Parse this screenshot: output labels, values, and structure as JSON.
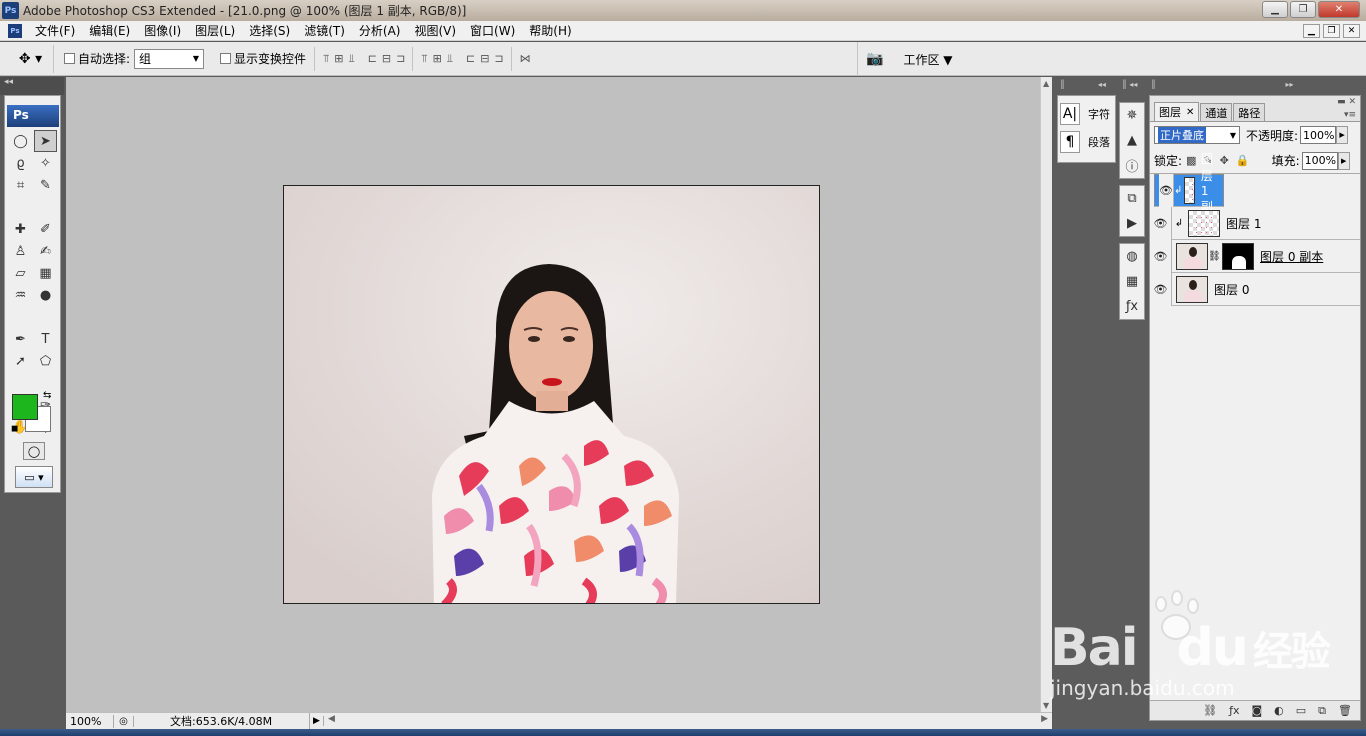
{
  "window": {
    "title": "Adobe Photoshop CS3 Extended - [21.0.png @ 100% (图层 1 副本, RGB/8)]",
    "app_icon": "Ps"
  },
  "menu": [
    "文件(F)",
    "编辑(E)",
    "图像(I)",
    "图层(L)",
    "选择(S)",
    "滤镜(T)",
    "分析(A)",
    "视图(V)",
    "窗口(W)",
    "帮助(H)"
  ],
  "options": {
    "auto_select_label": "自动选择:",
    "auto_select_value": "组",
    "show_transform_label": "显示变换控件",
    "workspace_label": "工作区"
  },
  "toolbox": {
    "logo": "Ps",
    "fg_color": "#1db71d",
    "bg_color": "#ffffff"
  },
  "statusbar": {
    "zoom": "100%",
    "doc_info": "文档:653.6K/4.08M"
  },
  "char_panel": {
    "char_label": "字符",
    "para_label": "段落"
  },
  "layers_panel": {
    "tabs": [
      "图层",
      "通道",
      "路径"
    ],
    "blend_mode": "正片叠底",
    "opacity_label": "不透明度:",
    "opacity": "100%",
    "lock_label": "锁定:",
    "fill_label": "填充:",
    "fill": "100%",
    "layers": [
      {
        "name": "图层 1 副本",
        "selected": true
      },
      {
        "name": "图层 1",
        "selected": false
      },
      {
        "name": "图层 0 副本",
        "selected": false
      },
      {
        "name": "图层 0",
        "selected": false
      }
    ]
  },
  "watermark": {
    "brand": "Bai",
    "brand2": "du",
    "cn": "经验",
    "url": "jingyan.baidu.com"
  }
}
